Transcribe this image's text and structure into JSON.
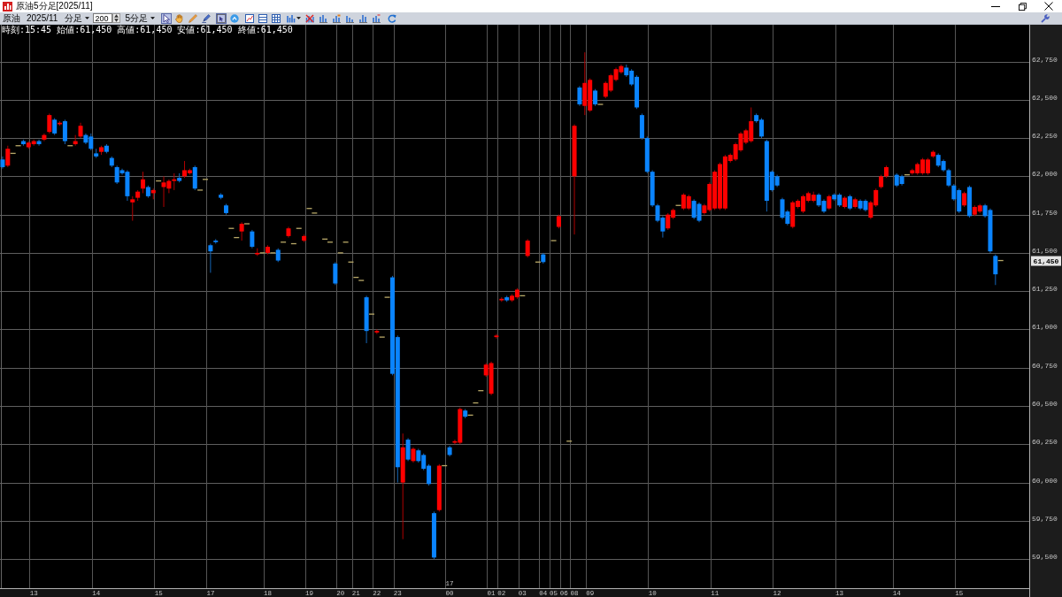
{
  "window": {
    "title": "原油5分足[2025/11]"
  },
  "toolbar": {
    "symbol": "原油",
    "contract_month": "2025/11",
    "bar_unit": "分足",
    "bar_count": "200",
    "interval": "5分足",
    "drawing_tools": [
      {
        "selected": true
      },
      {
        "selected": false
      },
      {
        "selected": false
      },
      {
        "selected": false
      }
    ],
    "view_tools": [
      {
        "selected": true
      },
      {
        "selected": false
      }
    ]
  },
  "chart": {
    "info": "時刻:15:45 始値:61,450 高値:61,450 安値:61,450 終値:61,450",
    "current_price": "61,450",
    "day_marker": "17",
    "chart_data": {
      "type": "candlestick",
      "grid": true,
      "ylim": [
        59310,
        62990
      ],
      "yticks": [
        {
          "value": 62750,
          "label": "62,750"
        },
        {
          "value": 62500,
          "label": "62,500"
        },
        {
          "value": 62250,
          "label": "62,250"
        },
        {
          "value": 62000,
          "label": "62,000"
        },
        {
          "value": 61750,
          "label": "61,750"
        },
        {
          "value": 61500,
          "label": "61,500"
        },
        {
          "value": 61250,
          "label": "61,250"
        },
        {
          "value": 61000,
          "label": "61,000"
        },
        {
          "value": 60750,
          "label": "60,750"
        },
        {
          "value": 60500,
          "label": "60,500"
        },
        {
          "value": 60250,
          "label": "60,250"
        },
        {
          "value": 60000,
          "label": "60,000"
        },
        {
          "value": 59750,
          "label": "59,750"
        },
        {
          "value": 59500,
          "label": "59,500"
        }
      ],
      "categories": [
        null,
        null,
        null,
        null,
        null,
        null,
        "13",
        null,
        null,
        null,
        null,
        null,
        null,
        null,
        null,
        null,
        null,
        null,
        "14",
        null,
        null,
        null,
        null,
        null,
        null,
        null,
        null,
        null,
        null,
        null,
        "15",
        null,
        null,
        null,
        null,
        null,
        null,
        null,
        null,
        null,
        "17",
        null,
        null,
        null,
        null,
        null,
        null,
        null,
        null,
        null,
        null,
        "18",
        null,
        null,
        null,
        null,
        null,
        null,
        null,
        "19",
        null,
        null,
        null,
        null,
        null,
        "20",
        null,
        null,
        "21",
        null,
        null,
        null,
        "22",
        null,
        null,
        null,
        "23",
        null,
        null,
        null,
        null,
        null,
        null,
        null,
        null,
        null,
        "00",
        null,
        null,
        null,
        null,
        null,
        null,
        null,
        "01",
        null,
        "02",
        null,
        null,
        null,
        "03",
        null,
        null,
        null,
        "04",
        null,
        "05",
        null,
        "06",
        null,
        "08",
        null,
        null,
        "09",
        null,
        null,
        null,
        null,
        null,
        null,
        null,
        null,
        null,
        null,
        null,
        "10",
        null,
        null,
        null,
        null,
        null,
        null,
        null,
        null,
        null,
        null,
        null,
        "11",
        null,
        null,
        null,
        null,
        null,
        null,
        null,
        null,
        null,
        null,
        null,
        "12",
        null,
        null,
        null,
        null,
        null,
        null,
        null,
        null,
        null,
        null,
        null,
        "13",
        null,
        null,
        null,
        null,
        null,
        null,
        null,
        null,
        null,
        null,
        "14",
        null,
        null,
        null,
        null,
        null,
        null,
        null,
        null,
        null,
        null,
        null,
        "15",
        null,
        null,
        null,
        null,
        null,
        null,
        null,
        null,
        null,
        null,
        null,
        null,
        null
      ],
      "ohlc": [
        [
          62110,
          62130,
          62050,
          62060
        ],
        [
          62070,
          62200,
          62060,
          62180
        ],
        [
          62150,
          62150,
          62150,
          62150
        ],
        [
          62200,
          62200,
          62200,
          62200
        ],
        [
          62230,
          62240,
          62200,
          62210
        ],
        [
          62190,
          62230,
          62180,
          62220
        ],
        [
          62210,
          62240,
          62200,
          62230
        ],
        [
          62230,
          62240,
          62200,
          62210
        ],
        [
          62240,
          62280,
          62230,
          62270
        ],
        [
          62290,
          62410,
          62280,
          62400
        ],
        [
          62370,
          62380,
          62270,
          62280
        ],
        [
          62340,
          62360,
          62330,
          62350
        ],
        [
          62360,
          62370,
          62210,
          62230
        ],
        [
          62200,
          62200,
          62200,
          62200
        ],
        [
          62210,
          62270,
          62200,
          62230
        ],
        [
          62260,
          62350,
          62250,
          62330
        ],
        [
          62270,
          62280,
          62210,
          62220
        ],
        [
          62260,
          62280,
          62170,
          62180
        ],
        [
          62150,
          62180,
          62120,
          62130
        ],
        [
          62160,
          62200,
          62140,
          62190
        ],
        [
          62200,
          62210,
          62150,
          62160
        ],
        [
          62120,
          62130,
          62060,
          62070
        ],
        [
          62060,
          62070,
          61950,
          61960
        ],
        [
          62040,
          62050,
          62010,
          62020
        ],
        [
          62030,
          62040,
          61840,
          61870
        ],
        [
          61830,
          61870,
          61710,
          61850
        ],
        [
          61860,
          61910,
          61840,
          61900
        ],
        [
          61920,
          62030,
          61890,
          61980
        ],
        [
          61930,
          61940,
          61860,
          61870
        ],
        [
          61890,
          61920,
          61850,
          61910
        ],
        [
          61970,
          61970,
          61970,
          61970
        ],
        [
          61930,
          62000,
          61800,
          61960
        ],
        [
          61920,
          61980,
          61890,
          61970
        ],
        [
          61970,
          62020,
          61910,
          61980
        ],
        [
          61990,
          62020,
          61960,
          61970
        ],
        [
          62000,
          62100,
          61990,
          62040
        ],
        [
          62020,
          62050,
          62010,
          62040
        ],
        [
          62060,
          62070,
          61910,
          61920
        ],
        [
          61910,
          61910,
          61910,
          61910
        ],
        [
          61980,
          61980,
          61980,
          61980
        ],
        [
          61550,
          61560,
          61370,
          61510
        ],
        [
          61580,
          61590,
          61560,
          61570
        ],
        [
          61880,
          61890,
          61850,
          61860
        ],
        [
          61810,
          61820,
          61750,
          61760
        ],
        [
          61660,
          61660,
          61660,
          61660
        ],
        [
          61600,
          61600,
          61600,
          61600
        ],
        [
          61640,
          61700,
          61580,
          61690
        ],
        [
          61690,
          61690,
          61690,
          61690
        ],
        [
          61640,
          61650,
          61530,
          61540
        ],
        [
          61490,
          61530,
          61480,
          61500
        ],
        [
          61500,
          61500,
          61500,
          61500
        ],
        [
          61500,
          61550,
          61490,
          61540
        ],
        [
          61500,
          61500,
          61500,
          61500
        ],
        [
          61520,
          61530,
          61440,
          61450
        ],
        [
          61570,
          61570,
          61570,
          61570
        ],
        [
          61610,
          61670,
          61600,
          61660
        ],
        [
          61560,
          61560,
          61560,
          61560
        ],
        [
          61660,
          61660,
          61660,
          61660
        ],
        [
          61580,
          61620,
          61570,
          61610
        ],
        [
          61790,
          61790,
          61790,
          61790
        ],
        [
          61760,
          61760,
          61760,
          61760
        ],
        null,
        [
          61590,
          61590,
          61590,
          61590
        ],
        [
          61570,
          61570,
          61570,
          61570
        ],
        [
          61430,
          61440,
          61290,
          61300
        ],
        [
          61500,
          61500,
          61500,
          61500
        ],
        [
          61570,
          61570,
          61570,
          61570
        ],
        [
          61440,
          61440,
          61440,
          61440
        ],
        [
          61340,
          61340,
          61340,
          61340
        ],
        [
          61320,
          61320,
          61320,
          61320
        ],
        [
          61210,
          61220,
          60910,
          60990
        ],
        [
          61100,
          61100,
          61100,
          61100
        ],
        [
          60980,
          61000,
          60970,
          60990
        ],
        [
          60950,
          60950,
          60950,
          60950
        ],
        [
          61210,
          61210,
          61210,
          61210
        ],
        [
          61340,
          61350,
          60700,
          60710
        ],
        [
          60950,
          60960,
          60000,
          60100
        ],
        [
          60000,
          60320,
          59630,
          60230
        ],
        [
          60280,
          60290,
          60140,
          60150
        ],
        [
          60140,
          60230,
          60130,
          60220
        ],
        [
          60210,
          60220,
          60130,
          60140
        ],
        [
          60180,
          60190,
          60080,
          60090
        ],
        [
          60110,
          60120,
          59980,
          59990
        ],
        [
          59800,
          59810,
          59500,
          59510
        ],
        [
          59820,
          60120,
          59810,
          60110
        ],
        [
          60110,
          60110,
          60110,
          60110
        ],
        [
          60230,
          60240,
          60170,
          60180
        ],
        [
          60260,
          60280,
          60250,
          60270
        ],
        [
          60260,
          60490,
          60250,
          60480
        ],
        [
          60470,
          60480,
          60420,
          60430
        ],
        [
          60440,
          60440,
          60440,
          60440
        ],
        [
          60520,
          60520,
          60520,
          60520
        ],
        [
          60600,
          60600,
          60600,
          60600
        ],
        [
          60700,
          60780,
          60690,
          60770
        ],
        [
          60580,
          60790,
          60570,
          60780
        ],
        [
          60950,
          60970,
          60940,
          60960
        ],
        [
          61190,
          61210,
          61180,
          61200
        ],
        [
          61210,
          61220,
          61180,
          61190
        ],
        [
          61190,
          61230,
          61180,
          61220
        ],
        [
          61210,
          61270,
          61200,
          61260
        ],
        [
          61220,
          61220,
          61220,
          61220
        ],
        [
          61480,
          61590,
          61470,
          61580
        ],
        null,
        [
          61440,
          61440,
          61440,
          61440
        ],
        [
          61490,
          61500,
          61430,
          61440
        ],
        null,
        [
          61580,
          61580,
          61580,
          61580
        ],
        [
          61670,
          61750,
          61660,
          61740
        ],
        null,
        [
          60270,
          60270,
          60270,
          60270
        ],
        [
          62000,
          62340,
          61620,
          62330
        ],
        [
          62580,
          62590,
          62460,
          62470
        ],
        [
          62460,
          62810,
          62400,
          62610
        ],
        [
          62430,
          62640,
          62420,
          62630
        ],
        [
          62560,
          62570,
          62460,
          62470
        ],
        [
          62470,
          62470,
          62470,
          62470
        ],
        [
          62520,
          62620,
          62510,
          62610
        ],
        [
          62560,
          62670,
          62550,
          62660
        ],
        [
          62630,
          62710,
          62620,
          62700
        ],
        [
          62680,
          62730,
          62670,
          62720
        ],
        [
          62710,
          62730,
          62650,
          62660
        ],
        [
          62690,
          62700,
          62590,
          62600
        ],
        [
          62650,
          62660,
          62440,
          62450
        ],
        [
          62400,
          62410,
          62240,
          62250
        ],
        [
          62250,
          62260,
          62020,
          62030
        ],
        [
          62030,
          62040,
          61800,
          61810
        ],
        [
          61810,
          61820,
          61700,
          61710
        ],
        [
          61730,
          61740,
          61600,
          61640
        ],
        [
          61660,
          61760,
          61650,
          61750
        ],
        [
          61730,
          61790,
          61720,
          61780
        ],
        [
          61810,
          61810,
          61810,
          61810
        ],
        [
          61790,
          61890,
          61780,
          61880
        ],
        [
          61790,
          61880,
          61780,
          61870
        ],
        [
          61840,
          61850,
          61720,
          61730
        ],
        [
          61820,
          61830,
          61700,
          61710
        ],
        [
          61760,
          61820,
          61750,
          61810
        ],
        [
          61780,
          61960,
          61770,
          61950
        ],
        [
          61790,
          62040,
          61780,
          62030
        ],
        [
          61790,
          62090,
          61780,
          62080
        ],
        [
          61790,
          62140,
          61780,
          62130
        ],
        [
          62100,
          62150,
          62090,
          62140
        ],
        [
          62110,
          62220,
          62100,
          62210
        ],
        [
          62170,
          62290,
          62160,
          62280
        ],
        [
          62220,
          62310,
          62210,
          62300
        ],
        [
          62230,
          62450,
          62220,
          62360
        ],
        [
          62400,
          62410,
          62350,
          62360
        ],
        [
          62370,
          62380,
          62250,
          62260
        ],
        [
          62230,
          62240,
          61770,
          61840
        ],
        [
          62030,
          62040,
          61900,
          61910
        ],
        [
          62000,
          62010,
          61930,
          61940
        ],
        [
          61850,
          61860,
          61720,
          61730
        ],
        [
          61770,
          61780,
          61680,
          61690
        ],
        [
          61670,
          61840,
          61660,
          61830
        ],
        [
          61800,
          61850,
          61790,
          61840
        ],
        [
          61770,
          61880,
          61760,
          61870
        ],
        [
          61840,
          61900,
          61830,
          61890
        ],
        [
          61840,
          61900,
          61830,
          61880
        ],
        [
          61880,
          61890,
          61800,
          61810
        ],
        [
          61840,
          61850,
          61760,
          61770
        ],
        [
          61790,
          61880,
          61780,
          61870
        ],
        [
          61880,
          61890,
          61840,
          61850
        ],
        [
          61880,
          61890,
          61800,
          61810
        ],
        [
          61800,
          61870,
          61790,
          61860
        ],
        [
          61870,
          61880,
          61780,
          61790
        ],
        [
          61800,
          61860,
          61790,
          61850
        ],
        [
          61840,
          61850,
          61780,
          61790
        ],
        [
          61840,
          61850,
          61770,
          61780
        ],
        [
          61730,
          61840,
          61720,
          61830
        ],
        [
          61810,
          61920,
          61800,
          61910
        ],
        [
          61930,
          62010,
          61920,
          62000
        ],
        [
          62000,
          62070,
          61990,
          62060
        ],
        null,
        [
          62010,
          62020,
          61930,
          61940
        ],
        [
          62000,
          62010,
          61940,
          61950
        ],
        [
          62010,
          62010,
          62010,
          62010
        ],
        [
          62020,
          62050,
          62010,
          62040
        ],
        [
          62020,
          62090,
          62010,
          62080
        ],
        [
          62020,
          62120,
          62010,
          62110
        ],
        [
          62020,
          62120,
          62010,
          62110
        ],
        [
          62130,
          62170,
          62120,
          62160
        ],
        [
          62140,
          62150,
          62060,
          62070
        ],
        [
          62100,
          62110,
          62030,
          62040
        ],
        [
          62040,
          62050,
          61930,
          61940
        ],
        [
          61940,
          61950,
          61840,
          61850
        ],
        [
          61910,
          61920,
          61760,
          61770
        ],
        [
          61810,
          61900,
          61800,
          61890
        ],
        [
          61930,
          61940,
          61730,
          61740
        ],
        [
          61750,
          61810,
          61740,
          61800
        ],
        [
          61770,
          61820,
          61760,
          61810
        ],
        [
          61810,
          61820,
          61730,
          61740
        ],
        [
          61780,
          61790,
          61500,
          61510
        ],
        [
          61480,
          61490,
          61290,
          61360
        ],
        [
          61450,
          61450,
          61450,
          61450
        ],
        null,
        null,
        null,
        null,
        null
      ]
    }
  }
}
